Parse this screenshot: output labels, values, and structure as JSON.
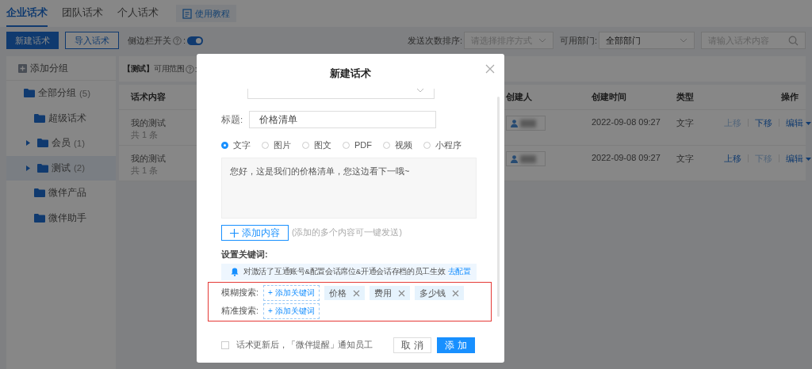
{
  "tabs": [
    {
      "label": "企业话术",
      "selected": true
    },
    {
      "label": "团队话术",
      "selected": false
    },
    {
      "label": "个人话术",
      "selected": false
    }
  ],
  "tutorial_button": "使用教程",
  "toolbar": {
    "new_button": "新建话术",
    "import_button": "导入话术",
    "sidebar_switch": {
      "label": "侧边栏开关",
      "suffix": ":",
      "on": true
    },
    "sort": {
      "label": "发送次数排序:",
      "placeholder": "请选择排序方式"
    },
    "department": {
      "label": "可用部门:",
      "value": "全部部门"
    },
    "search": {
      "placeholder": "请输入话术内容"
    }
  },
  "sidebar": {
    "add_group": "添加分组",
    "groups": [
      {
        "label": "全部分组",
        "count": "(5)",
        "selected": false,
        "expandable": false,
        "children": [
          {
            "label": "超级话术",
            "selected": false,
            "expandable": false
          },
          {
            "label": "会员",
            "count": "(1)",
            "selected": false,
            "expandable": true
          },
          {
            "label": "测试",
            "count": "(2)",
            "selected": true,
            "expandable": true
          },
          {
            "label": "微伴产品",
            "selected": false,
            "expandable": false
          },
          {
            "label": "微伴助手",
            "selected": false,
            "expandable": false
          }
        ]
      }
    ]
  },
  "group_header": {
    "title": "【测试】",
    "scope_label": "可用范围",
    "suffix": ":"
  },
  "table": {
    "columns": [
      "话术内容",
      "创建人",
      "创建时间",
      "类型",
      "操作"
    ],
    "rows": [
      {
        "title": "我的测试",
        "count": "共 1 条",
        "created": "2022-09-08 09:27",
        "type": "文字",
        "move_up": {
          "label": "上移",
          "disabled": true
        },
        "move_down": {
          "label": "下移",
          "disabled": false
        },
        "edit": "编辑"
      },
      {
        "title": "我的测试",
        "count": "共 1 条",
        "created": "2022-09-08 09:27",
        "type": "文字",
        "move_up": {
          "label": "上移",
          "disabled": false
        },
        "move_down": {
          "label": "下移",
          "disabled": true
        },
        "edit": "编辑"
      }
    ]
  },
  "dialog": {
    "title": "新建话术",
    "title_field": {
      "label": "标题:",
      "value": "价格清单"
    },
    "content_types": [
      {
        "label": "文字",
        "selected": true
      },
      {
        "label": "图片",
        "selected": false
      },
      {
        "label": "图文",
        "selected": false
      },
      {
        "label": "PDF",
        "selected": false
      },
      {
        "label": "视频",
        "selected": false
      },
      {
        "label": "小程序",
        "selected": false
      }
    ],
    "message": "您好，这是我们的价格清单，您这边看下一哦~",
    "add_content_button": "添加内容",
    "add_content_hint": "(添加的多个内容可一键发送)",
    "keywords_heading": "设置关键词:",
    "notice": {
      "text": "对激活了互通账号&配置会话席位&开通会话存档的员工生效",
      "link": "去配置"
    },
    "keyword_rows": [
      {
        "label": "模糊搜索:",
        "add_button": "+ 添加关键词",
        "tags": [
          "价格",
          "费用",
          "多少钱"
        ]
      },
      {
        "label": "精准搜索:",
        "add_button": "+ 添加关键词"
      }
    ],
    "notify": {
      "label": "话术更新后，「微伴提醒」通知员工",
      "checked": false
    },
    "cancel_button": "取 消",
    "confirm_button": "添 加"
  }
}
